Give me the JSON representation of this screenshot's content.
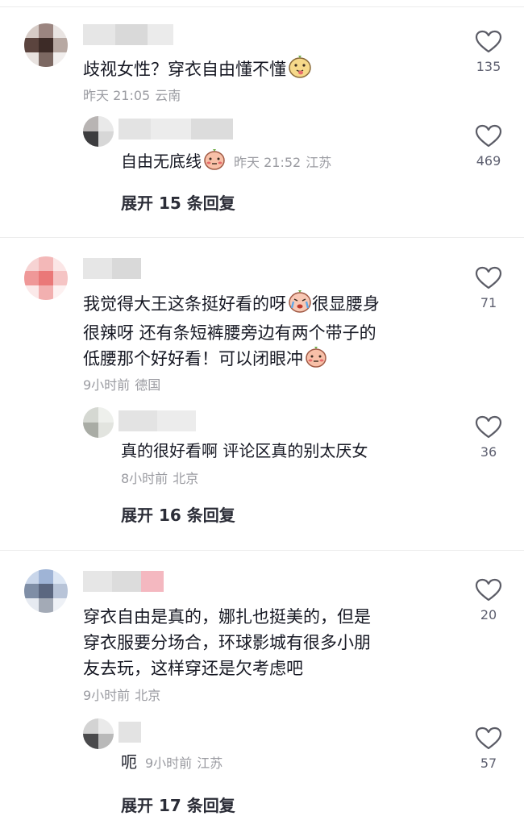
{
  "threads": [
    {
      "comment": {
        "text": "歧视女性？穿衣自由懂不懂",
        "time": "昨天 21:05",
        "location": "云南",
        "likes": "135"
      },
      "reply": {
        "text": "自由无底线",
        "time": "昨天 21:52",
        "location": "江苏",
        "likes": "469"
      },
      "expand": "展开 15 条回复"
    },
    {
      "comment": {
        "line1": "我觉得大王这条挺好看的呀",
        "line1b": "很显腰身",
        "line2": "很辣呀 还有条短裤腰旁边有两个带子的",
        "line3": "低腰那个好好看！可以闭眼冲",
        "time": "9小时前",
        "location": "德国",
        "likes": "71"
      },
      "reply": {
        "text": "真的很好看啊 评论区真的别太厌女",
        "time": "8小时前",
        "location": "北京",
        "likes": "36"
      },
      "expand": "展开 16 条回复"
    },
    {
      "comment": {
        "line1": "穿衣自由是真的，娜扎也挺美的，但是",
        "line2": "穿衣服要分场合，环球影城有很多小朋",
        "line3": "友去玩，这样穿还是欠考虑吧",
        "time": "9小时前",
        "location": "北京",
        "likes": "20"
      },
      "reply": {
        "text": "呃",
        "time": "9小时前",
        "location": "江苏",
        "likes": "57"
      },
      "expand": "展开 17 条回复"
    }
  ],
  "icons": {
    "like": "heart-outline-icon",
    "emoji_tongue": "tongue-out-emoji-icon",
    "emoji_blush": "blushing-emoji-icon",
    "emoji_cry": "crying-emoji-icon"
  },
  "colors": {
    "text": "#161823",
    "meta": "#9a9ba1",
    "expand": "#2b2d37",
    "heart": "#5b5c66"
  }
}
